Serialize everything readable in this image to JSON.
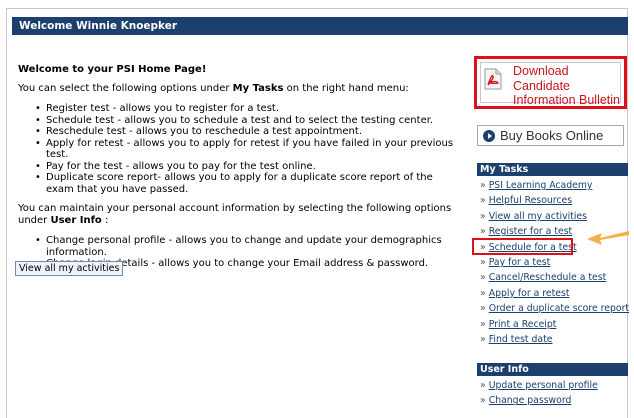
{
  "header": {
    "welcome": "Welcome Winnie Knoepker"
  },
  "main": {
    "heading": "Welcome to your PSI Home Page!",
    "intro_before": "You can select the following options under ",
    "intro_bold": "My Tasks",
    "intro_after": " on the right hand menu:",
    "task_bullets": [
      "Register test - allows you to register for a test.",
      "Schedule test - allows you to schedule a test and to select the testing center.",
      "Reschedule test - allows you to reschedule a test appointment.",
      "Apply for retest - allows you to apply for retest if you have failed in your previous test.",
      "Pay for the test - allows you to pay for the test online.",
      "Duplicate score report- allows you to apply for a duplicate score report of the exam that you have passed."
    ],
    "account_before": "You can maintain your personal account information by selecting the following options under ",
    "account_bold": "User Info",
    "account_after": " :",
    "info_bullets": [
      "Change personal profile - allows you to change and update your demographics information.",
      "Change login details - allows you to change your Email address & password."
    ],
    "view_button": "View all my activities"
  },
  "sidebar": {
    "bulletin_line1": "Download Candidate",
    "bulletin_line2": "Information Bulletin",
    "buy_books": "Buy Books Online",
    "tasks_title": "My Tasks",
    "tasks": [
      "PSI Learning Academy",
      "Helpful Resources",
      "View all my activities",
      "Register for a test",
      "Schedule for a test",
      "Pay for a test",
      "Cancel/Reschedule a test",
      "Apply for a retest",
      "Order a duplicate score report",
      "Print a Receipt",
      "Find test date"
    ],
    "user_info_title": "User Info",
    "user_info": [
      "Update personal profile",
      "Change password"
    ],
    "bullet_glyph": "»"
  },
  "colors": {
    "navy": "#1c3f6e",
    "highlight_red": "#e0101a",
    "arrow_orange": "#f5b04a"
  }
}
